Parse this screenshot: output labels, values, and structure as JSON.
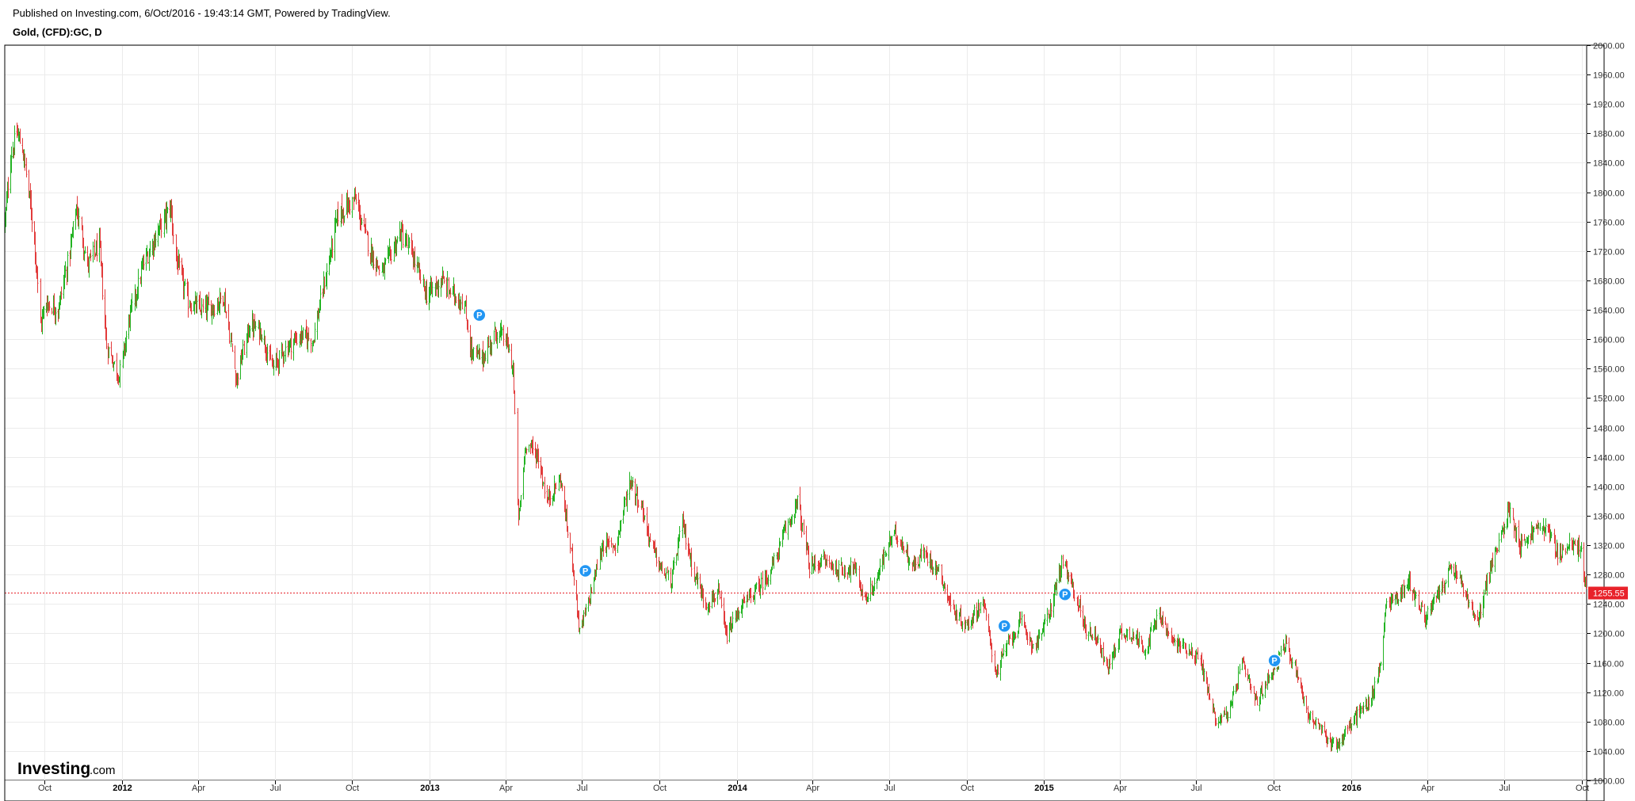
{
  "header": {
    "published": "Published on Investing.com, 6/Oct/2016 - 19:43:14 GMT, Powered by TradingView.",
    "symbol": "Gold, (CFD):GC, D"
  },
  "logo": {
    "brand": "Investing",
    "suffix": ".com"
  },
  "colors": {
    "up": "#22b322",
    "down": "#e23b3b",
    "grid": "#ebebeb",
    "price_line": "#e8222a",
    "marker": "#2196f3",
    "frame": "#000000"
  },
  "chart_data": {
    "type": "candlestick",
    "instrument": "Gold, (CFD):GC",
    "interval": "D",
    "ylim": [
      1000,
      2000
    ],
    "y_ticks": [
      "1000.00",
      "1040.00",
      "1080.00",
      "1120.00",
      "1160.00",
      "1200.00",
      "1240.00",
      "1280.00",
      "1320.00",
      "1360.00",
      "1400.00",
      "1440.00",
      "1480.00",
      "1520.00",
      "1560.00",
      "1600.00",
      "1640.00",
      "1680.00",
      "1720.00",
      "1760.00",
      "1800.00",
      "1840.00",
      "1880.00",
      "1920.00",
      "1960.00",
      "2000.00"
    ],
    "x_ticks": [
      {
        "label": "Oct",
        "date": "2011-10-01",
        "bold": false
      },
      {
        "label": "2012",
        "date": "2012-01-01",
        "bold": true
      },
      {
        "label": "Apr",
        "date": "2012-04-01",
        "bold": false
      },
      {
        "label": "Jul",
        "date": "2012-07-01",
        "bold": false
      },
      {
        "label": "Oct",
        "date": "2012-10-01",
        "bold": false
      },
      {
        "label": "2013",
        "date": "2013-01-01",
        "bold": true
      },
      {
        "label": "Apr",
        "date": "2013-04-01",
        "bold": false
      },
      {
        "label": "Jul",
        "date": "2013-07-01",
        "bold": false
      },
      {
        "label": "Oct",
        "date": "2013-10-01",
        "bold": false
      },
      {
        "label": "2014",
        "date": "2014-01-01",
        "bold": true
      },
      {
        "label": "Apr",
        "date": "2014-04-01",
        "bold": false
      },
      {
        "label": "Jul",
        "date": "2014-07-01",
        "bold": false
      },
      {
        "label": "Oct",
        "date": "2014-10-01",
        "bold": false
      },
      {
        "label": "2015",
        "date": "2015-01-01",
        "bold": true
      },
      {
        "label": "Apr",
        "date": "2015-04-01",
        "bold": false
      },
      {
        "label": "Jul",
        "date": "2015-07-01",
        "bold": false
      },
      {
        "label": "Oct",
        "date": "2015-10-01",
        "bold": false
      },
      {
        "label": "2016",
        "date": "2016-01-01",
        "bold": true
      },
      {
        "label": "Apr",
        "date": "2016-04-01",
        "bold": false
      },
      {
        "label": "Jul",
        "date": "2016-07-01",
        "bold": false
      },
      {
        "label": "Oct",
        "date": "2016-10-01",
        "bold": false
      }
    ],
    "x_range": [
      "2011-08-15",
      "2016-10-07"
    ],
    "last_price": 1255.55,
    "last_price_label": "1255.55",
    "price_path": [
      [
        "2011-08-15",
        1760
      ],
      [
        "2011-08-22",
        1850
      ],
      [
        "2011-08-29",
        1880
      ],
      [
        "2011-09-05",
        1860
      ],
      [
        "2011-09-12",
        1800
      ],
      [
        "2011-09-19",
        1740
      ],
      [
        "2011-09-26",
        1620
      ],
      [
        "2011-10-03",
        1650
      ],
      [
        "2011-10-17",
        1640
      ],
      [
        "2011-10-31",
        1720
      ],
      [
        "2011-11-08",
        1780
      ],
      [
        "2011-11-21",
        1700
      ],
      [
        "2011-12-05",
        1730
      ],
      [
        "2011-12-14",
        1590
      ],
      [
        "2011-12-29",
        1550
      ],
      [
        "2012-01-10",
        1630
      ],
      [
        "2012-01-26",
        1700
      ],
      [
        "2012-02-10",
        1740
      ],
      [
        "2012-02-28",
        1780
      ],
      [
        "2012-03-05",
        1710
      ],
      [
        "2012-03-20",
        1650
      ],
      [
        "2012-04-05",
        1640
      ],
      [
        "2012-04-20",
        1645
      ],
      [
        "2012-05-01",
        1660
      ],
      [
        "2012-05-16",
        1545
      ],
      [
        "2012-06-01",
        1620
      ],
      [
        "2012-06-15",
        1610
      ],
      [
        "2012-06-28",
        1560
      ],
      [
        "2012-07-15",
        1590
      ],
      [
        "2012-08-01",
        1605
      ],
      [
        "2012-08-15",
        1600
      ],
      [
        "2012-08-31",
        1690
      ],
      [
        "2012-09-14",
        1770
      ],
      [
        "2012-10-04",
        1790
      ],
      [
        "2012-10-22",
        1720
      ],
      [
        "2012-11-05",
        1690
      ],
      [
        "2012-11-27",
        1745
      ],
      [
        "2012-12-11",
        1715
      ],
      [
        "2012-12-28",
        1660
      ],
      [
        "2013-01-15",
        1680
      ],
      [
        "2013-01-25",
        1665
      ],
      [
        "2013-02-10",
        1650
      ],
      [
        "2013-02-20",
        1580
      ],
      [
        "2013-03-05",
        1575
      ],
      [
        "2013-03-20",
        1610
      ],
      [
        "2013-04-01",
        1600
      ],
      [
        "2013-04-10",
        1560
      ],
      [
        "2013-04-16",
        1350
      ],
      [
        "2013-04-25",
        1460
      ],
      [
        "2013-05-10",
        1440
      ],
      [
        "2013-05-20",
        1380
      ],
      [
        "2013-06-05",
        1410
      ],
      [
        "2013-06-20",
        1290
      ],
      [
        "2013-06-28",
        1200
      ],
      [
        "2013-07-10",
        1250
      ],
      [
        "2013-07-25",
        1320
      ],
      [
        "2013-08-10",
        1320
      ],
      [
        "2013-08-27",
        1410
      ],
      [
        "2013-09-10",
        1370
      ],
      [
        "2013-09-20",
        1325
      ],
      [
        "2013-10-01",
        1290
      ],
      [
        "2013-10-15",
        1270
      ],
      [
        "2013-10-28",
        1350
      ],
      [
        "2013-11-10",
        1285
      ],
      [
        "2013-11-25",
        1240
      ],
      [
        "2013-12-10",
        1255
      ],
      [
        "2013-12-19",
        1195
      ],
      [
        "2014-01-05",
        1235
      ],
      [
        "2014-01-25",
        1260
      ],
      [
        "2014-02-10",
        1285
      ],
      [
        "2014-02-26",
        1335
      ],
      [
        "2014-03-14",
        1380
      ],
      [
        "2014-03-28",
        1290
      ],
      [
        "2014-04-15",
        1300
      ],
      [
        "2014-05-01",
        1285
      ],
      [
        "2014-05-20",
        1290
      ],
      [
        "2014-06-02",
        1245
      ],
      [
        "2014-06-15",
        1270
      ],
      [
        "2014-07-01",
        1325
      ],
      [
        "2014-07-10",
        1335
      ],
      [
        "2014-07-30",
        1290
      ],
      [
        "2014-08-10",
        1310
      ],
      [
        "2014-08-29",
        1285
      ],
      [
        "2014-09-15",
        1230
      ],
      [
        "2014-10-01",
        1210
      ],
      [
        "2014-10-20",
        1245
      ],
      [
        "2014-11-05",
        1145
      ],
      [
        "2014-11-20",
        1190
      ],
      [
        "2014-12-05",
        1215
      ],
      [
        "2014-12-20",
        1180
      ],
      [
        "2015-01-05",
        1220
      ],
      [
        "2015-01-22",
        1295
      ],
      [
        "2015-02-05",
        1260
      ],
      [
        "2015-02-20",
        1205
      ],
      [
        "2015-03-05",
        1195
      ],
      [
        "2015-03-17",
        1150
      ],
      [
        "2015-04-01",
        1200
      ],
      [
        "2015-04-15",
        1200
      ],
      [
        "2015-05-01",
        1180
      ],
      [
        "2015-05-18",
        1225
      ],
      [
        "2015-06-01",
        1190
      ],
      [
        "2015-06-20",
        1180
      ],
      [
        "2015-07-05",
        1165
      ],
      [
        "2015-07-24",
        1080
      ],
      [
        "2015-08-10",
        1095
      ],
      [
        "2015-08-24",
        1160
      ],
      [
        "2015-09-10",
        1105
      ],
      [
        "2015-09-25",
        1140
      ],
      [
        "2015-10-14",
        1185
      ],
      [
        "2015-10-28",
        1150
      ],
      [
        "2015-11-10",
        1090
      ],
      [
        "2015-11-25",
        1070
      ],
      [
        "2015-12-03",
        1055
      ],
      [
        "2015-12-17",
        1050
      ],
      [
        "2016-01-05",
        1085
      ],
      [
        "2016-01-25",
        1110
      ],
      [
        "2016-02-05",
        1160
      ],
      [
        "2016-02-11",
        1240
      ],
      [
        "2016-02-25",
        1250
      ],
      [
        "2016-03-10",
        1270
      ],
      [
        "2016-03-28",
        1220
      ],
      [
        "2016-04-10",
        1245
      ],
      [
        "2016-04-29",
        1290
      ],
      [
        "2016-05-10",
        1270
      ],
      [
        "2016-05-30",
        1210
      ],
      [
        "2016-06-10",
        1275
      ],
      [
        "2016-06-24",
        1320
      ],
      [
        "2016-07-06",
        1370
      ],
      [
        "2016-07-20",
        1320
      ],
      [
        "2016-08-05",
        1340
      ],
      [
        "2016-08-20",
        1345
      ],
      [
        "2016-09-01",
        1310
      ],
      [
        "2016-09-20",
        1320
      ],
      [
        "2016-09-30",
        1315
      ],
      [
        "2016-10-04",
        1270
      ],
      [
        "2016-10-06",
        1255
      ]
    ],
    "markers": [
      {
        "label": "P",
        "date": "2013-03-01",
        "value": 1633
      },
      {
        "label": "P",
        "date": "2013-07-05",
        "value": 1285
      },
      {
        "label": "P",
        "date": "2014-11-15",
        "value": 1210
      },
      {
        "label": "P",
        "date": "2015-01-26",
        "value": 1253
      },
      {
        "label": "P",
        "date": "2015-10-02",
        "value": 1163
      }
    ]
  }
}
